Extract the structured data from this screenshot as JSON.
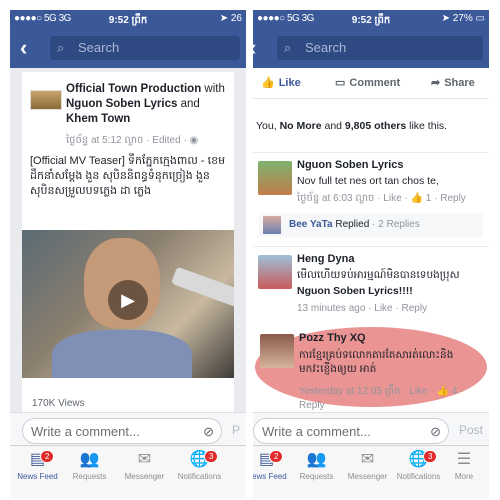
{
  "status": {
    "signal": "●●●●○",
    "network_a": "5G",
    "network_b": "3G",
    "time": "9:52 ព្រឹក",
    "battery_left": "26",
    "battery_right": "27%"
  },
  "nav": {
    "search_placeholder": "Search"
  },
  "post": {
    "author": "Official Town Production",
    "with_word": " with ",
    "tagged": "Nguon Soben Lyrics",
    "and_word": " and ",
    "tagged2": "Khem Town",
    "time": "ថ្ងៃច័ន្ទ at 5:12 ល្ងាច · Edited · ",
    "text": "[Official MV Teaser] ទឹកភ្នែកក្មេងពាល - ខេមដឹកនាំសម្ដែង ងួន សុបិននិពន្ធទំនុកច្រៀង ងួន សុបិនសម្រួលបទភ្លេង ដា ភ្លេង",
    "views": "170K Views"
  },
  "actions": {
    "like": "Like",
    "comment": "Comment",
    "share": "Share"
  },
  "likes_line": {
    "prefix": "You, ",
    "person": "No More",
    "middle": " and ",
    "others": "9,805 others",
    "suffix": " like this."
  },
  "comments": [
    {
      "name": "Nguon Soben Lyrics",
      "text": "Nov full tet nes ort tan chos te,",
      "time": "ថ្ងៃច័ន្ទ at 6:03 ល្ងាច · ",
      "like": "Like",
      "likes": "1",
      "reply": "Reply"
    },
    {
      "name": "Heng Dyna",
      "text": "មើលហើយទប់អារម្មណ៍មិនបានទេបងប្រុស",
      "mention": "Nguon Soben Lyrics!!!!",
      "time": "13 minutes ago · ",
      "like": "Like",
      "reply": "Reply"
    },
    {
      "name": "Pozz Thy XQ",
      "text": "ការខ្មែរគ្រប់ទលោកតារតែសារត់លោះនិង មកវះខ្ញើងឲ្យយ អាត់",
      "time": "Yesterday at 12:05 ព្រឹក · ",
      "like": "Like",
      "likes": "4",
      "reply": "Reply"
    }
  ],
  "reply_summary": {
    "name": "Bee YaTa",
    "verb": " Replied",
    "count": " · 2 Replies"
  },
  "write": {
    "placeholder": "Write a comment...",
    "post": "Post",
    "post_short": "P"
  },
  "tabs": [
    {
      "label": "News Feed",
      "icon": "▤",
      "badge": "2"
    },
    {
      "label": "Requests",
      "icon": "👥"
    },
    {
      "label": "Messenger",
      "icon": "✉"
    },
    {
      "label": "Notifications",
      "icon": "🌐",
      "badge": "3"
    },
    {
      "label": "More",
      "icon": "☰"
    }
  ],
  "colors": {
    "brand": "#3b5998",
    "highlight": "#e05b5b"
  }
}
